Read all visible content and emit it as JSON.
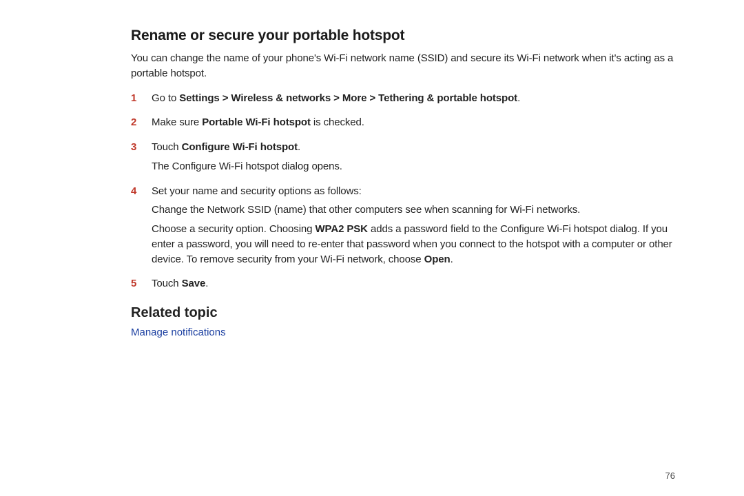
{
  "section_title": "Rename or secure your portable hotspot",
  "intro": "You can change the name of your phone's Wi-Fi network name (SSID) and secure its Wi-Fi network when it's acting as a portable hotspot.",
  "steps": {
    "s1": {
      "num": "1",
      "prefix": "Go to ",
      "bold": "Settings > Wireless & networks > More > Tethering & portable hotspot",
      "suffix": "."
    },
    "s2": {
      "num": "2",
      "prefix": "Make sure ",
      "bold": "Portable Wi-Fi hotspot",
      "suffix": " is checked."
    },
    "s3": {
      "num": "3",
      "prefix": "Touch ",
      "bold": "Configure Wi-Fi hotspot",
      "suffix": ".",
      "followup": "The Configure Wi-Fi hotspot dialog opens."
    },
    "s4": {
      "num": "4",
      "line1": "Set your name and security options as follows:",
      "line2": "Change the Network SSID (name) that other computers see when scanning for Wi-Fi networks.",
      "line3_pre": "Choose a security option. Choosing ",
      "line3_bold1": "WPA2 PSK",
      "line3_mid": " adds a password field to the Configure Wi-Fi hotspot dialog. If you enter a password, you will need to re-enter that password when you connect to the hotspot with a computer or other device. To remove security from your Wi-Fi network, choose ",
      "line3_bold2": "Open",
      "line3_post": "."
    },
    "s5": {
      "num": "5",
      "prefix": "Touch ",
      "bold": "Save",
      "suffix": "."
    }
  },
  "related_title": "Related topic",
  "related_link": "Manage notifications",
  "page_number": "76"
}
